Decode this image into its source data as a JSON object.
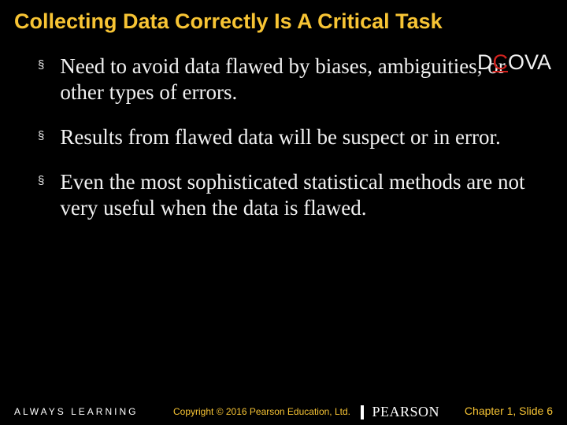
{
  "title": "Collecting Data Correctly Is A Critical Task",
  "dcova": {
    "d": "D",
    "c": "C",
    "ova": "OVA"
  },
  "bullets": [
    "Need to avoid data flawed by biases, ambiguities, or other types of errors.",
    "Results from flawed data will be suspect or in error.",
    "Even the most sophisticated statistical methods are not very useful when the data is flawed."
  ],
  "footer": {
    "always_learning": "ALWAYS LEARNING",
    "copyright": "Copyright © 2016 Pearson Education, Ltd.",
    "pearson": "PEARSON",
    "slide_number": "Chapter 1, Slide 6"
  }
}
